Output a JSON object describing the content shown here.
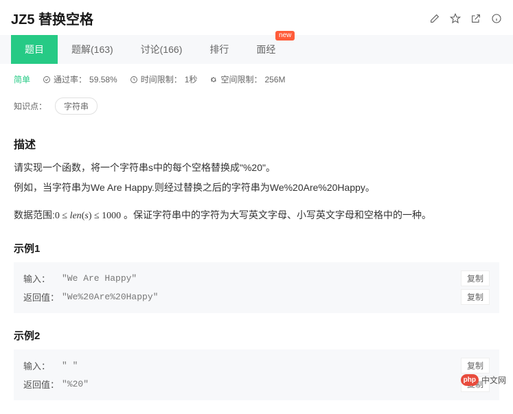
{
  "header": {
    "title": "JZ5 替换空格"
  },
  "tabs": {
    "problem": "题目",
    "solutions": "题解(163)",
    "discuss": "讨论(166)",
    "ranking": "排行",
    "interview": "面经",
    "badge": "new"
  },
  "meta": {
    "difficulty": "简单",
    "pass_label": "通过率：",
    "pass_value": "59.58%",
    "time_label": "时间限制：",
    "time_value": "1秒",
    "space_label": "空间限制：",
    "space_value": "256M"
  },
  "tags": {
    "label": "知识点：",
    "items": [
      "字符串"
    ]
  },
  "description": {
    "heading": "描述",
    "p1": "请实现一个函数，将一个字符串s中的每个空格替换成\"%20\"。",
    "p2": "例如，当字符串为We Are Happy.则经过替换之后的字符串为We%20Are%20Happy。",
    "range_prefix": "数据范围:",
    "range_math": "0 ≤ len(s) ≤ 1000",
    "range_suffix": " 。保证字符串中的字符为大写英文字母、小写英文字母和空格中的一种。"
  },
  "examples": [
    {
      "heading": "示例1",
      "input_label": "输入：",
      "input_value": "\"We Are Happy\"",
      "output_label": "返回值：",
      "output_value": "\"We%20Are%20Happy\"",
      "copy": "复制"
    },
    {
      "heading": "示例2",
      "input_label": "输入：",
      "input_value": "\" \"",
      "output_label": "返回值：",
      "output_value": "\"%20\"",
      "copy": "复制"
    }
  ],
  "brand": {
    "logo": "php",
    "text": "中文网"
  }
}
